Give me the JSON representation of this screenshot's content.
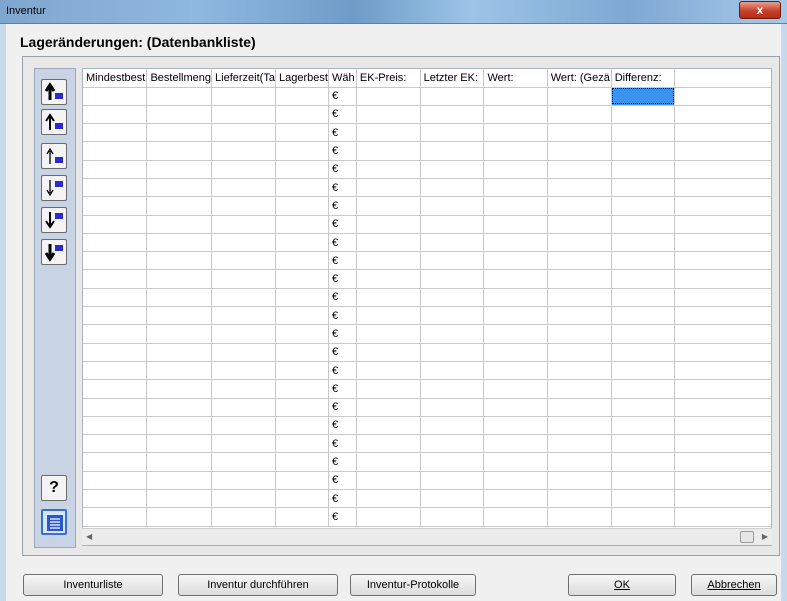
{
  "window": {
    "title": "Inventur",
    "close_label": "x"
  },
  "heading": "Lageränderungen: (Datenbankliste)",
  "toolbar": {
    "help_label": "?"
  },
  "grid": {
    "columns": [
      "Mindestbest",
      "Bestellmeng",
      "Lieferzeit(Ta",
      "Lagerbest",
      "Wäh",
      "EK-Preis:",
      "Letzter EK:",
      "Wert:",
      "Wert: (Gezä",
      "Differenz:"
    ],
    "currency_symbol": "€",
    "row_count": 24
  },
  "buttons": {
    "inventurliste": "Inventurliste",
    "durchfuehren": "Inventur durchführen",
    "protokolle": "Inventur-Protokolle",
    "ok": "OK",
    "abbrechen": "Abbrechen"
  }
}
